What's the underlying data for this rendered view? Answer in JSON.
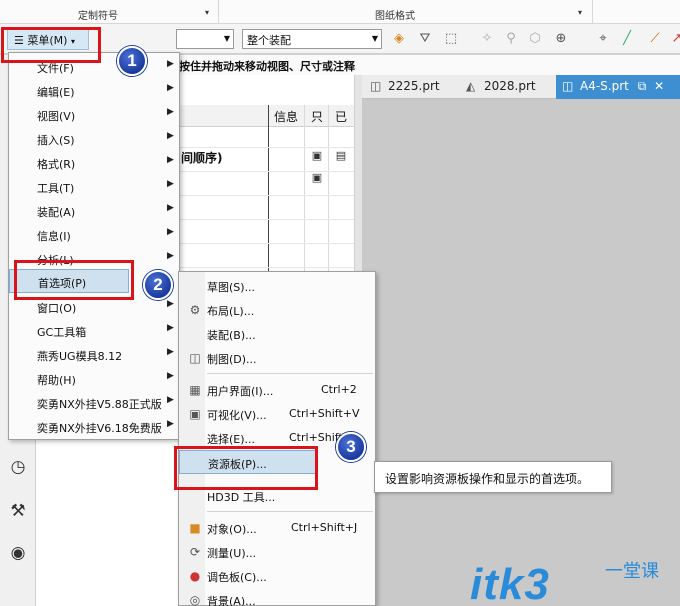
{
  "ribbon": {
    "group1": "定制符号",
    "group2": "图纸格式"
  },
  "toolbar": {
    "menu_label": "菜单(M)",
    "filter_value": "",
    "assembly_value": "整个装配"
  },
  "hint": "按住并拖动来移动视图、尺寸或注释",
  "navigator": {
    "col_info": "信息",
    "col_readonly": "只",
    "col_modified": "已",
    "row_text": "间顺序)"
  },
  "tabs": [
    {
      "label": "2225.prt",
      "icon": "part-icon"
    },
    {
      "label": "2028.prt",
      "icon": "model-icon"
    },
    {
      "label": "A4-S.prt",
      "icon": "drawing-icon",
      "close": "✕",
      "active": true
    }
  ],
  "main_menu": {
    "items": [
      {
        "label": "文件(F)"
      },
      {
        "label": "编辑(E)"
      },
      {
        "label": "视图(V)"
      },
      {
        "label": "插入(S)"
      },
      {
        "label": "格式(R)"
      },
      {
        "label": "工具(T)"
      },
      {
        "label": "装配(A)"
      },
      {
        "label": "信息(I)"
      },
      {
        "label": "分析(L)"
      },
      {
        "label": "首选项(P)"
      },
      {
        "label": "窗口(O)"
      },
      {
        "label": "GC工具箱"
      },
      {
        "label": "燕秀UG模具8.12"
      },
      {
        "label": "帮助(H)"
      },
      {
        "label": "奕勇NX外挂V5.88正式版"
      },
      {
        "label": "奕勇NX外挂V6.18免费版"
      }
    ]
  },
  "preferences_menu": {
    "items": [
      {
        "label": "草图(S)...",
        "shortcut": ""
      },
      {
        "label": "布局(L)...",
        "shortcut": ""
      },
      {
        "label": "装配(B)...",
        "shortcut": ""
      },
      {
        "label": "制图(D)...",
        "shortcut": ""
      },
      {
        "label": "用户界面(I)...",
        "shortcut": "Ctrl+2"
      },
      {
        "label": "可视化(V)...",
        "shortcut": "Ctrl+Shift+V"
      },
      {
        "label": "选择(E)...",
        "shortcut": "Ctrl+Shift"
      },
      {
        "label": "资源板(P)...",
        "shortcut": ""
      },
      {
        "label": "HD3D 工具...",
        "shortcut": ""
      },
      {
        "label": "对象(O)...",
        "shortcut": "Ctrl+Shift+J"
      },
      {
        "label": "测量(U)...",
        "shortcut": ""
      },
      {
        "label": "调色板(C)...",
        "shortcut": ""
      },
      {
        "label": "背景(A)...",
        "shortcut": ""
      }
    ]
  },
  "tooltip": "设置影响资源板操作和显示的首选项。",
  "badges": [
    "1",
    "2",
    "3"
  ],
  "watermark": {
    "text": "itk3",
    "cn": "一堂课"
  },
  "colors": {
    "highlight_red": "#d9141b",
    "badge_blue": "#1a3a9e",
    "tab_active": "#3d8fd1",
    "watermark": "#2a8bd9"
  }
}
